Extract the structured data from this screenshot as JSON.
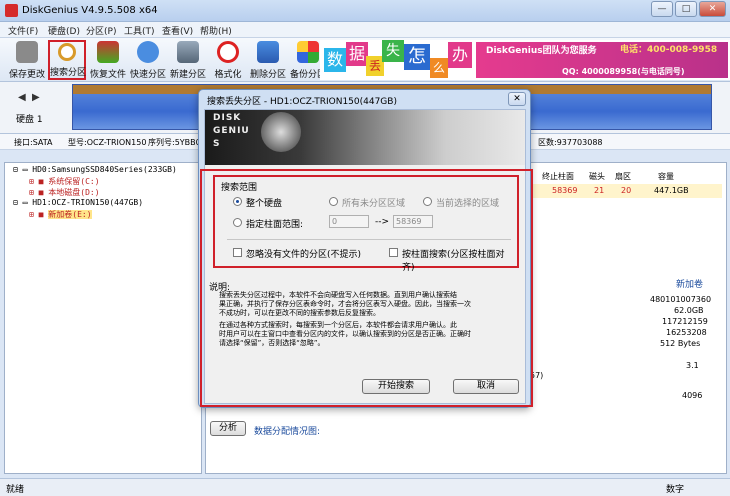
{
  "window": {
    "title": "DiskGenius V4.9.5.508 x64"
  },
  "menu": [
    "文件(F)",
    "硬盘(D)",
    "分区(P)",
    "工具(T)",
    "查看(V)",
    "帮助(H)"
  ],
  "toolbar": [
    {
      "label": "保存更改",
      "icon": "save-icon"
    },
    {
      "label": "搜索分区",
      "icon": "magnifier-icon"
    },
    {
      "label": "恢复文件",
      "icon": "recover-file-icon"
    },
    {
      "label": "快速分区",
      "icon": "quick-partition-icon"
    },
    {
      "label": "新建分区",
      "icon": "new-partition-icon"
    },
    {
      "label": "格式化",
      "icon": "format-icon"
    },
    {
      "label": "删除分区",
      "icon": "delete-partition-icon"
    },
    {
      "label": "备份分区",
      "icon": "backup-partition-icon"
    }
  ],
  "banner": {
    "chars": [
      "数",
      "据",
      "丢",
      "失",
      "怎",
      "么",
      "办"
    ],
    "title": "DiskGenius团队为您服务",
    "phone": "电话：400-008-9958",
    "qq": "QQ: 4000089958(与电话同号)"
  },
  "diskbar": {
    "label": "硬盘 1"
  },
  "infobar": {
    "interface": "接口:SATA",
    "model": "型号:OCZ-TRION150",
    "serial": "序列号:5YBB0",
    "sectors": "区数:937703088"
  },
  "tree": [
    {
      "text": "HD0:SamsungSSD840Series(233GB)",
      "level": 0
    },
    {
      "text": "系统保留(C:)",
      "level": 1
    },
    {
      "text": "本地磁盘(D:)",
      "level": 1
    },
    {
      "text": "HD1:OCZ-TRION150(447GB)",
      "level": 0
    },
    {
      "text": "新加卷(E:)",
      "level": 1
    }
  ],
  "table": {
    "headers": [
      "终止柱面",
      "磁头",
      "扇区",
      "容量"
    ],
    "row": [
      "58369",
      "21",
      "20",
      "447.1GB"
    ]
  },
  "props": {
    "volume_name": "新加卷",
    "values": [
      "480101007360",
      "62.0GB",
      "117212159",
      "16253208",
      "512 Bytes",
      "3.1",
      "57)",
      "4096"
    ]
  },
  "analysis": {
    "button": "分析",
    "label": "数据分配情况图:"
  },
  "status": {
    "left": "就绪",
    "right": "数字"
  },
  "dialog": {
    "title": "搜索丢失分区 - HD1:OCZ-TRION150(447GB)",
    "logo_letters": "DISK GENIUS",
    "range_title": "搜索范围",
    "opt_whole": "整个硬盘",
    "opt_unpartitioned": "所有未分区区域",
    "opt_selected": "当前选择的区域",
    "opt_cylinder": "指定柱面范围:",
    "cyl_from": "0",
    "cyl_sep": "-->",
    "cyl_to": "58369",
    "chk_ignore": "忽略没有文件的分区(不提示)",
    "chk_cylinder": "按柱面搜索(分区按柱面对齐)",
    "desc_title": "说明:",
    "desc_lines": [
      "搜索丢失分区过程中，本软件不会向硬盘写入任何数据。直到用户确认搜索结",
      "果正确，并执行了保存分区表命令时，才会将分区表写入硬盘。因此，当搜索一次",
      "不成功时，可以在更改不同的搜索参数后反复搜索。",
      "在通过各种方式搜索时，每搜索到一个分区后，本软件都会请求用户确认。此",
      "时用户可以在主窗口中查看分区内的文件，以确认搜索到的分区是否正确。正确时",
      "请选择“保留”，否则选择“忽略”。"
    ],
    "start_button": "开始搜索",
    "cancel_button": "取消"
  }
}
